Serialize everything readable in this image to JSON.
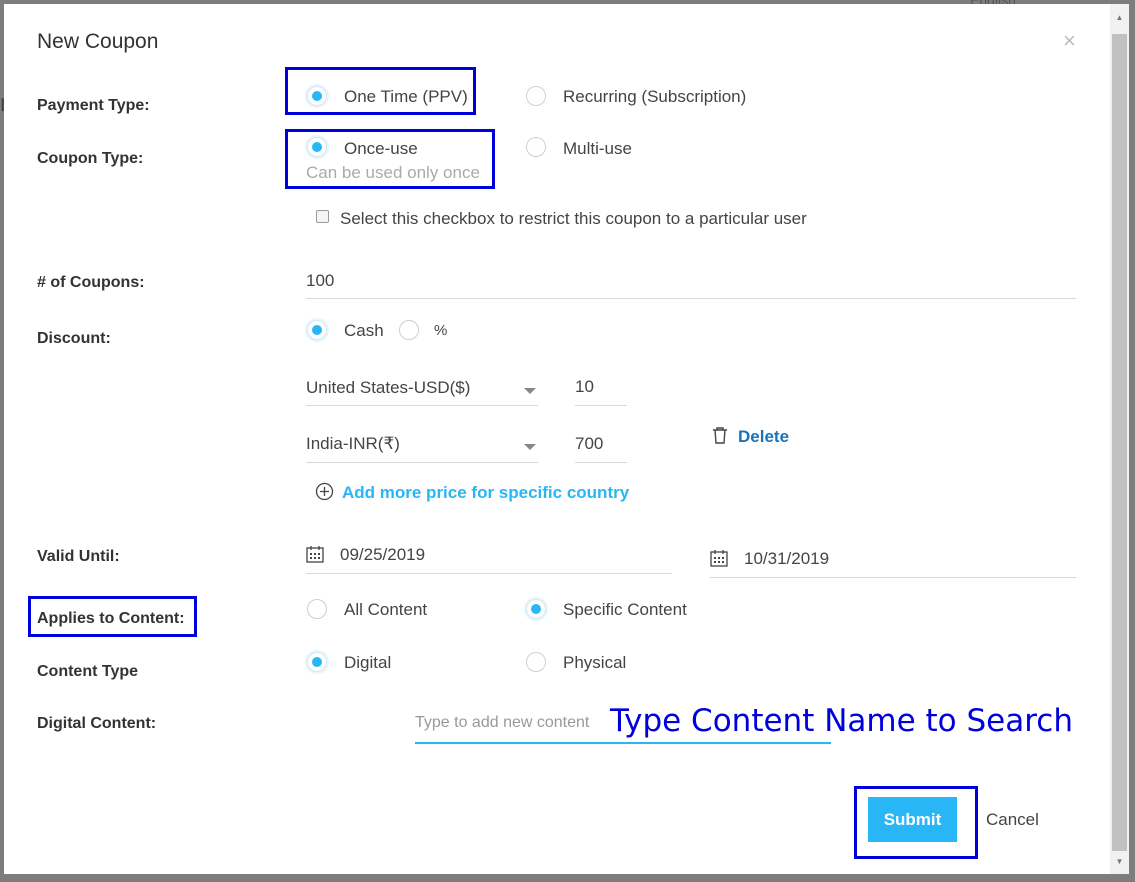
{
  "background": {
    "language": "English"
  },
  "modal": {
    "title": "New Coupon",
    "close_glyph": "×"
  },
  "payment_type": {
    "label": "Payment Type:",
    "options": [
      "One Time (PPV)",
      "Recurring (Subscription)"
    ],
    "selected": "One Time (PPV)"
  },
  "coupon_type": {
    "label": "Coupon Type:",
    "options": [
      "Once-use",
      "Multi-use"
    ],
    "selected": "Once-use",
    "hint": "Can be used only once"
  },
  "restrict_checkbox": {
    "label": "Select this checkbox to restrict this coupon to a particular user",
    "checked": false
  },
  "num_coupons": {
    "label": "# of Coupons:",
    "value": "100"
  },
  "discount": {
    "label": "Discount:",
    "options": [
      "Cash",
      "%"
    ],
    "selected": "Cash",
    "prices": [
      {
        "currency": "United States-USD($)",
        "amount": "10"
      },
      {
        "currency": "India-INR(₹)",
        "amount": "700"
      }
    ],
    "delete_label": "Delete",
    "add_more_label": "Add more price for specific country"
  },
  "valid_until": {
    "label": "Valid Until:",
    "start_date": "09/25/2019",
    "end_date": "10/31/2019"
  },
  "applies_to": {
    "label": "Applies to Content:",
    "options": [
      "All Content",
      "Specific Content"
    ],
    "selected": "Specific Content"
  },
  "content_type": {
    "label": "Content Type",
    "options": [
      "Digital",
      "Physical"
    ],
    "selected": "Digital"
  },
  "digital_content": {
    "label": "Digital Content:",
    "placeholder": "Type to add new content",
    "annotation": "Type Content Name to Search"
  },
  "actions": {
    "submit": "Submit",
    "cancel": "Cancel"
  },
  "colors": {
    "accent": "#29b6f6",
    "annotation_box": "#0000dd",
    "delete_link": "#1a73b8"
  }
}
